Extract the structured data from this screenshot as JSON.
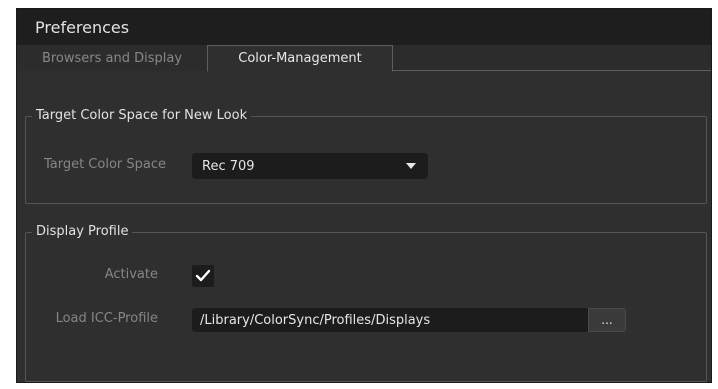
{
  "window": {
    "title": "Preferences"
  },
  "tabs": [
    {
      "label": "Browsers and Display",
      "active": false
    },
    {
      "label": "Color-Management",
      "active": true
    }
  ],
  "target_group": {
    "title": "Target Color Space for New Look",
    "label": "Target Color Space",
    "selected": "Rec 709"
  },
  "display_group": {
    "title": "Display Profile",
    "activate_label": "Activate",
    "activate_checked": true,
    "icc_label": "Load ICC-Profile",
    "icc_value": "/Library/ColorSync/Profiles/Displays",
    "browse_label": "..."
  },
  "icons": {
    "dropdown": "chevron-down-icon",
    "check": "checkmark-icon"
  },
  "colors": {
    "background": "#2f2f2f",
    "titlebar": "#1e1e1e",
    "field": "#1c1c1c"
  }
}
